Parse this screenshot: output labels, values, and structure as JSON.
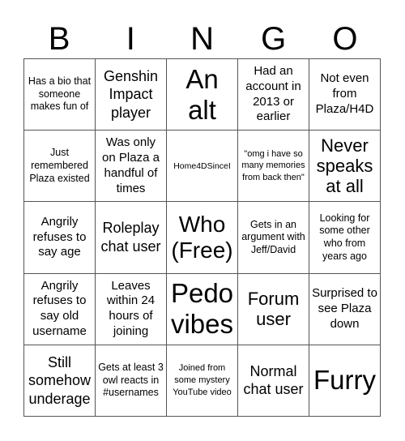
{
  "header": {
    "letters": [
      "B",
      "I",
      "N",
      "G",
      "O"
    ]
  },
  "card": {
    "rows": [
      [
        {
          "text": "Has a bio that someone makes fun of"
        },
        {
          "text": "Genshin Impact player"
        },
        {
          "text": "An alt"
        },
        {
          "text": "Had an account in 2013 or earlier"
        },
        {
          "text": "Not even from Plaza/H4D"
        }
      ],
      [
        {
          "text": "Just remembered Plaza existed"
        },
        {
          "text": "Was only on Plaza a handful of times"
        },
        {
          "text": "Home4DSinceI"
        },
        {
          "text": "\"omg i have so many memories from back then\""
        },
        {
          "text": "Never speaks at all"
        }
      ],
      [
        {
          "text": "Angrily refuses to say age"
        },
        {
          "text": "Roleplay chat user"
        },
        {
          "text": "Who (Free)"
        },
        {
          "text": "Gets in an argument with Jeff/David"
        },
        {
          "text": "Looking for some other who from years ago"
        }
      ],
      [
        {
          "text": "Angrily refuses to say old username"
        },
        {
          "text": "Leaves within 24 hours of joining"
        },
        {
          "text": "Pedo vibes"
        },
        {
          "text": "Forum user"
        },
        {
          "text": "Surprised to see Plaza down"
        }
      ],
      [
        {
          "text": "Still somehow underage"
        },
        {
          "text": "Gets at least 3 owl reacts in #usernames"
        },
        {
          "text": "Joined from some mystery YouTube video"
        },
        {
          "text": "Normal chat user"
        },
        {
          "text": "Furry"
        }
      ]
    ]
  }
}
